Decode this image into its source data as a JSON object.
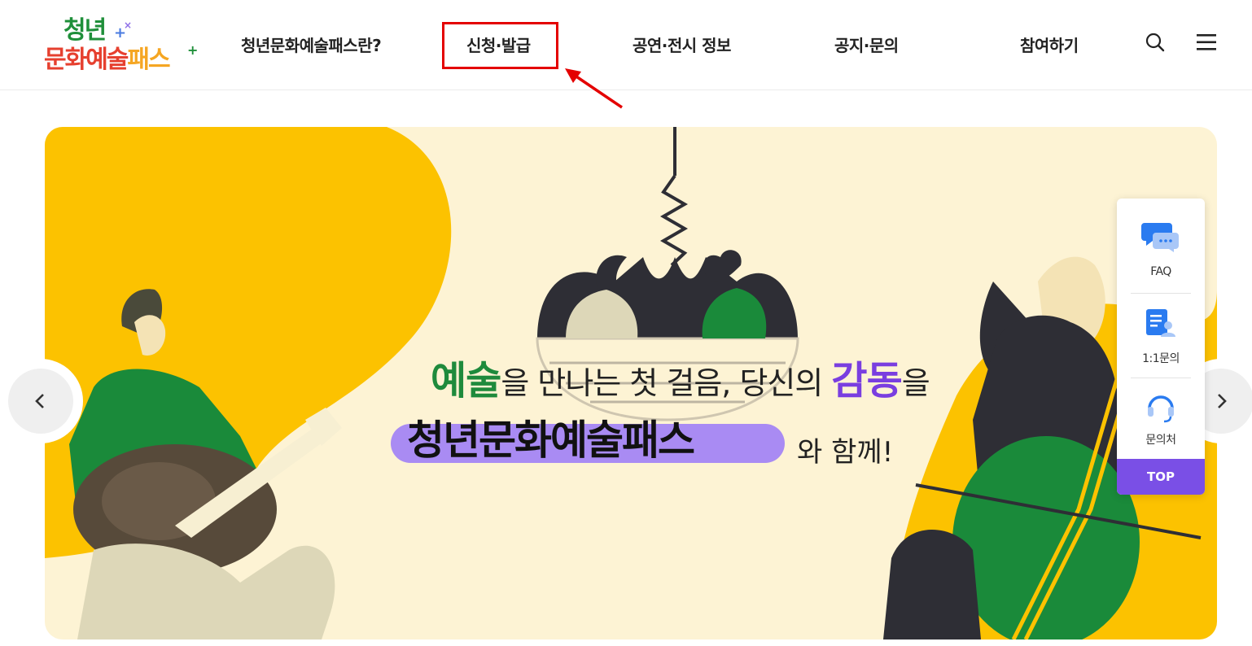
{
  "header": {
    "logo_line1": "청년",
    "logo_line2a": "문화예술",
    "logo_line2b": "패스",
    "nav": [
      {
        "label": "청년문화예술패스란?"
      },
      {
        "label": "신청·발급"
      },
      {
        "label": "공연·전시 정보"
      },
      {
        "label": "공지·문의"
      },
      {
        "label": "참여하기"
      }
    ],
    "icons": [
      "search-icon",
      "menu-icon"
    ]
  },
  "banner": {
    "line1_em1": "예술",
    "line1_mid": "을 만나는 첫 걸음, 당신의 ",
    "line1_em2": "감동",
    "line1_end": "을",
    "line2_main": "청년문화예술패스",
    "line2_end": "와 함께!"
  },
  "quick_menu": {
    "items": [
      {
        "label": "FAQ",
        "icon": "faq-chat-icon"
      },
      {
        "label": "1:1문의",
        "icon": "document-person-icon"
      },
      {
        "label": "문의처",
        "icon": "headset-icon"
      }
    ],
    "top_label": "TOP"
  },
  "colors": {
    "banner_yellow": "#fcc200",
    "green": "#1e8a3c",
    "purple": "#7a4fe6",
    "highlight_red": "#e40000"
  }
}
